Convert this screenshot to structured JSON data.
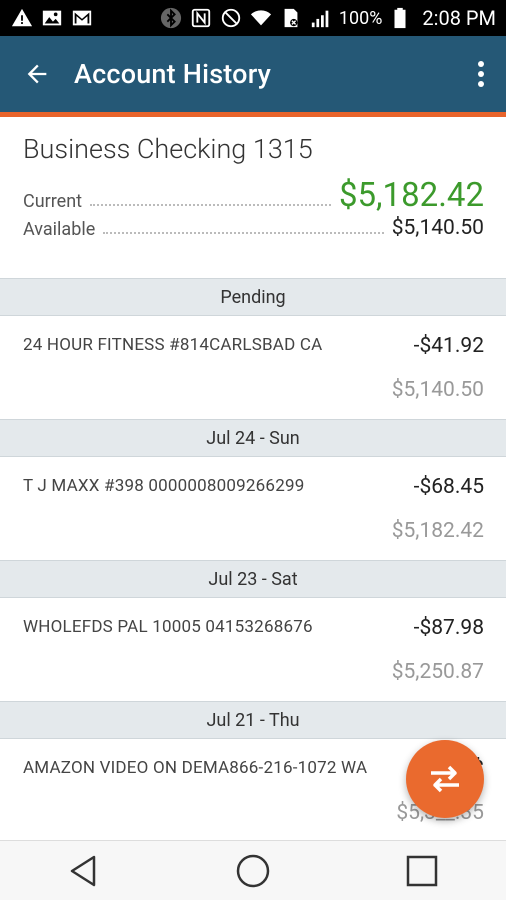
{
  "status_bar": {
    "battery": "100%",
    "time": "2:08 PM",
    "icons": [
      "warning-icon",
      "image-icon",
      "gmail-icon",
      "bluetooth-icon",
      "nfc-icon",
      "do-not-disturb-icon",
      "wifi-icon",
      "sim-icon",
      "signal-icon",
      "battery-icon"
    ]
  },
  "app_bar": {
    "title": "Account History",
    "back_icon": "arrow-back-icon",
    "menu_icon": "more-vert-icon",
    "color": "#255876",
    "accent": "#e8632b"
  },
  "account": {
    "name": "Business Checking 1315",
    "current_label": "Current",
    "current_value": "$5,182.42",
    "available_label": "Available",
    "available_value": "$5,140.50",
    "current_color": "#3c9a2c"
  },
  "sections": [
    {
      "header": "Pending",
      "transactions": [
        {
          "description": "24 HOUR FITNESS #814CARLSBAD CA",
          "amount": "-$41.92",
          "balance": "$5,140.50"
        }
      ]
    },
    {
      "header": "Jul 24 - Sun",
      "transactions": [
        {
          "description": "T J MAXX #398 0000008009266299",
          "amount": "-$68.45",
          "balance": "$5,182.42"
        }
      ]
    },
    {
      "header": "Jul 23 - Sat",
      "transactions": [
        {
          "description": "WHOLEFDS PAL 10005 04153268676",
          "amount": "-$87.98",
          "balance": "$5,250.87"
        }
      ]
    },
    {
      "header": "Jul 21 - Thu",
      "transactions": [
        {
          "description": "AMAZON VIDEO ON DEMA866-216-1072 WA",
          "amount": "-$",
          "balance": "$5,3__.35"
        }
      ]
    }
  ],
  "fab": {
    "icon": "swap-horiz-icon",
    "color": "#ea6a2e"
  },
  "nav_bar": {
    "icons": [
      "back-triangle-icon",
      "home-circle-icon",
      "recents-square-icon"
    ]
  }
}
